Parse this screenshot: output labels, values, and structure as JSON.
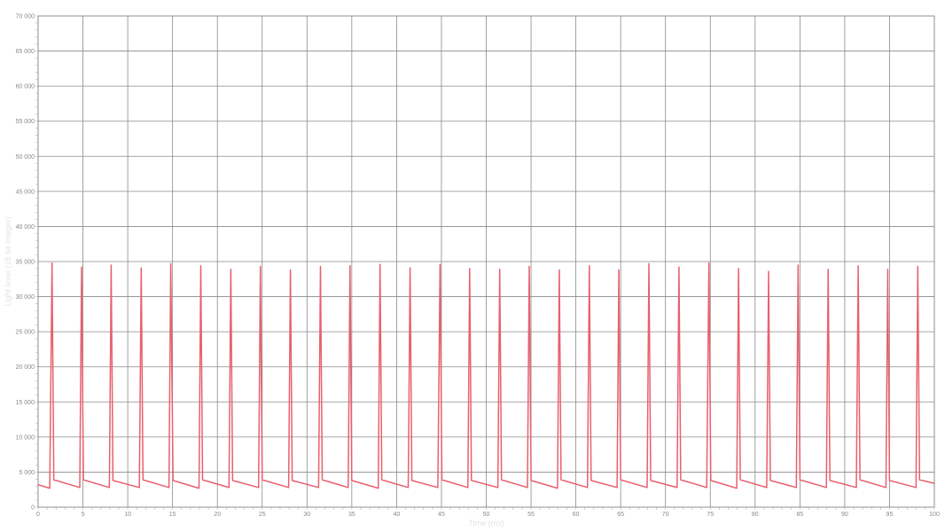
{
  "chart_data": {
    "type": "line",
    "title": "",
    "xlabel": "Time (ms)",
    "ylabel": "Light level (16 bit integer)",
    "xlim": [
      0,
      100
    ],
    "ylim": [
      0,
      70000
    ],
    "x_ticks": [
      0,
      5,
      10,
      15,
      20,
      25,
      30,
      35,
      40,
      45,
      50,
      55,
      60,
      65,
      70,
      75,
      80,
      85,
      90,
      95,
      100
    ],
    "x_tick_labels": [
      "0",
      "5",
      "10",
      "15",
      "20",
      "25",
      "30",
      "35",
      "40",
      "45",
      "50",
      "55",
      "60",
      "65",
      "70",
      "75",
      "80",
      "85",
      "90",
      "95",
      "100"
    ],
    "y_ticks": [
      0,
      5000,
      10000,
      15000,
      20000,
      25000,
      30000,
      35000,
      40000,
      45000,
      50000,
      55000,
      60000,
      65000,
      70000
    ],
    "y_tick_labels": [
      "0",
      "5 000",
      "10 000",
      "15 000",
      "20 000",
      "25 000",
      "30 000",
      "35 000",
      "40 000",
      "45 000",
      "50 000",
      "55 000",
      "60 000",
      "65 000",
      "70 000"
    ],
    "grid": true,
    "legend": "none",
    "series_color": "#e8606e",
    "series": [
      {
        "x": [
          0,
          1.3,
          1.55,
          1.75,
          4.65,
          4.85,
          5.05,
          7.95,
          8.15,
          8.35,
          11.3,
          11.5,
          11.7,
          14.6,
          14.8,
          15.05,
          17.95,
          18.15,
          18.35,
          21.3,
          21.5,
          21.7,
          24.6,
          24.8,
          25.0,
          27.95,
          28.15,
          28.35,
          31.3,
          31.5,
          31.7,
          34.6,
          34.8,
          35.0,
          37.95,
          38.15,
          38.35,
          41.3,
          41.5,
          41.7,
          44.6,
          44.85,
          45.05,
          47.95,
          48.15,
          48.35,
          51.3,
          51.5,
          51.7,
          54.6,
          54.8,
          55.0,
          57.95,
          58.15,
          58.35,
          61.3,
          61.5,
          61.7,
          64.6,
          64.8,
          65.0,
          67.95,
          68.15,
          68.35,
          71.3,
          71.5,
          71.7,
          74.6,
          74.85,
          75.05,
          77.95,
          78.15,
          78.35,
          81.3,
          81.5,
          81.7,
          84.6,
          84.8,
          85.0,
          87.95,
          88.15,
          88.35,
          91.3,
          91.5,
          91.7,
          94.6,
          94.8,
          95.0,
          97.95,
          98.15,
          98.35,
          100
        ],
        "y": [
          3200,
          2700,
          34800,
          3900,
          2800,
          34200,
          3900,
          2800,
          34500,
          3800,
          2800,
          34100,
          3900,
          2800,
          34700,
          3800,
          2700,
          34400,
          3900,
          2800,
          33900,
          3800,
          2800,
          34300,
          3900,
          2800,
          33800,
          3800,
          2800,
          34300,
          3900,
          2800,
          34400,
          3800,
          2700,
          34600,
          3900,
          2800,
          34100,
          3800,
          2800,
          34600,
          3900,
          2800,
          34000,
          3800,
          2800,
          33900,
          3900,
          2800,
          34300,
          3800,
          2700,
          33800,
          3900,
          2800,
          34400,
          3800,
          2800,
          33800,
          3900,
          2800,
          34700,
          3800,
          2800,
          34200,
          3900,
          2800,
          34800,
          3800,
          2700,
          34000,
          3900,
          2800,
          33600,
          3800,
          2800,
          34500,
          3900,
          2800,
          33900,
          3800,
          2800,
          34400,
          3900,
          2800,
          33900,
          3800,
          2800,
          34300,
          3900,
          3400
        ]
      }
    ]
  }
}
